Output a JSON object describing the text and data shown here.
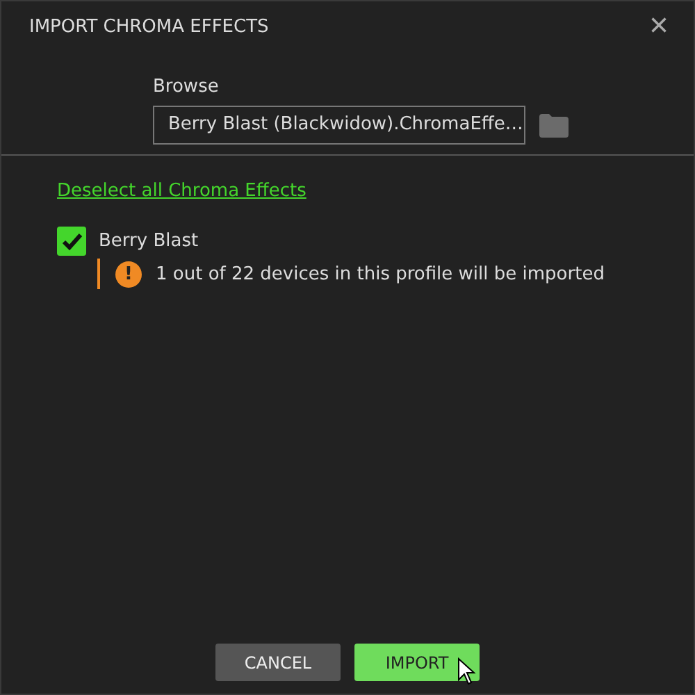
{
  "dialog": {
    "title": "IMPORT CHROMA EFFECTS",
    "close": "×"
  },
  "browse": {
    "label": "Browse",
    "value": "Berry Blast (Blackwidow).ChromaEffe…"
  },
  "deselect_link": "Deselect all Chroma Effects",
  "effects": [
    {
      "name": "Berry Blast",
      "checked": true,
      "warning": "1 out of 22 devices in this profile will be imported",
      "warning_mark": "!"
    }
  ],
  "buttons": [
    {
      "label": "CANCEL",
      "kind": "secondary"
    },
    {
      "label": "IMPORT",
      "kind": "primary"
    }
  ]
}
